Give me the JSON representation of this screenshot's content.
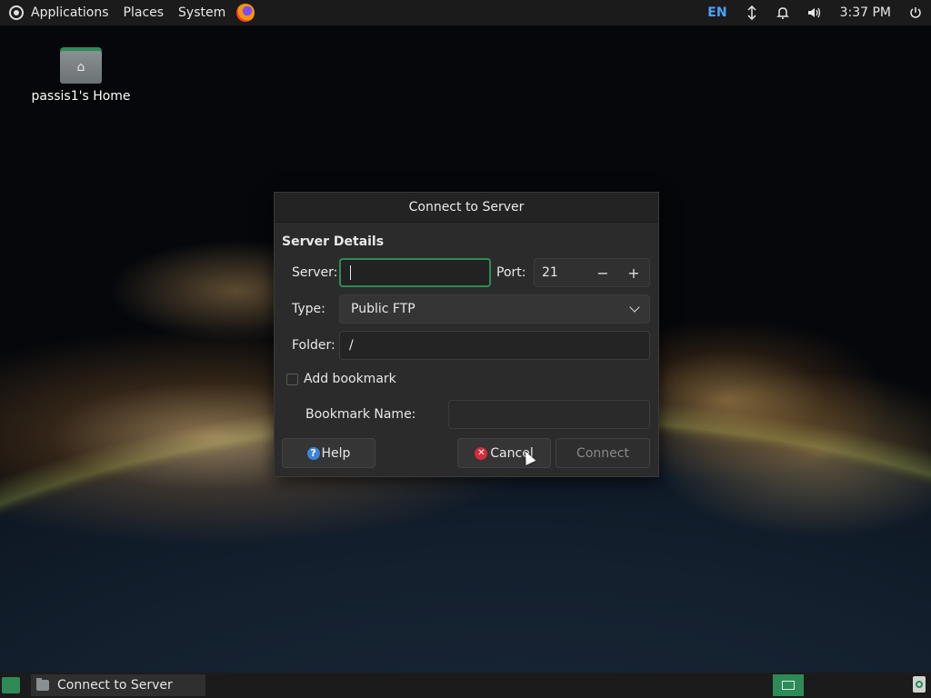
{
  "top_panel": {
    "applications": "Applications",
    "places": "Places",
    "system": "System",
    "language": "EN",
    "clock": "3:37 PM"
  },
  "desktop": {
    "home_label": "passis1's Home"
  },
  "dialog": {
    "title": "Connect to Server",
    "section_title": "Server Details",
    "server_label": "Server:",
    "server_value": "",
    "port_label": "Port:",
    "port_value": "21",
    "port_minus": "−",
    "port_plus": "+",
    "type_label": "Type:",
    "type_value": "Public FTP",
    "folder_label": "Folder:",
    "folder_value": "/",
    "add_bookmark_label": "Add bookmark",
    "bookmark_name_label": "Bookmark Name:",
    "bookmark_name_value": "",
    "help_label": "Help",
    "cancel_label": "Cancel",
    "connect_label": "Connect"
  },
  "taskbar": {
    "window_title": "Connect to Server"
  },
  "colors": {
    "accent": "#2e8b57",
    "panel": "#1b1b1b",
    "dialog_bg": "#2b2b2b"
  }
}
